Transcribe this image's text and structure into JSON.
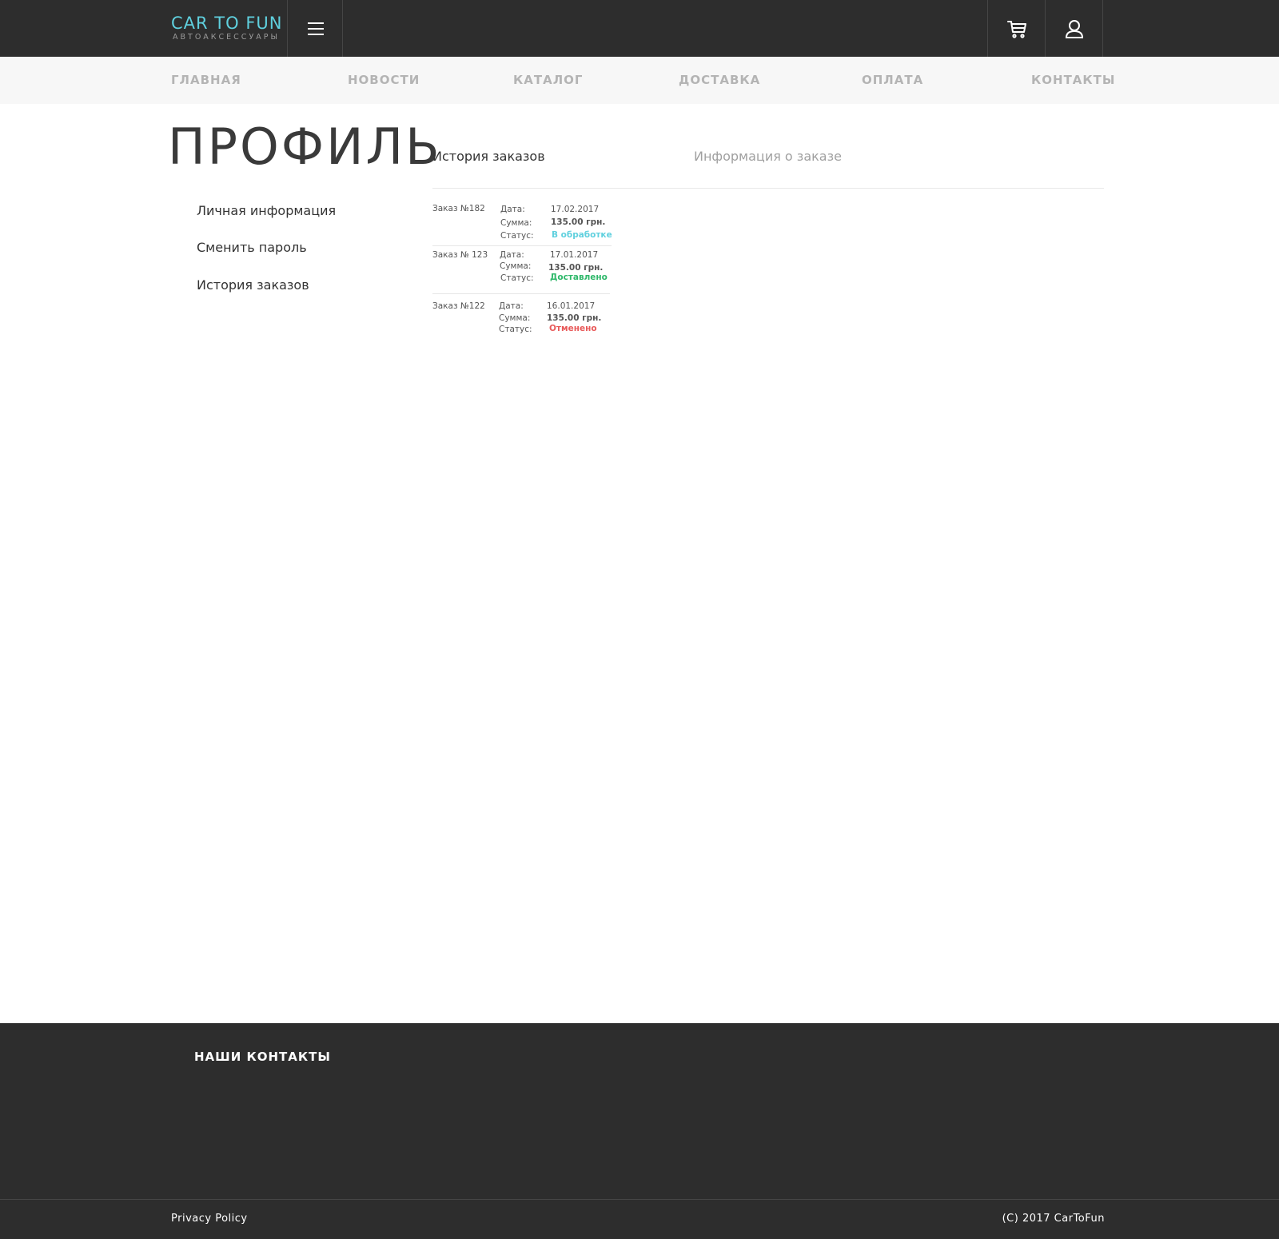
{
  "header": {
    "logo_title": "CAR TO FUN",
    "logo_subtitle": "АВТОАКСЕССУАРЫ",
    "menu_icon": "hamburger-menu-icon",
    "cart_icon": "cart-icon",
    "user_icon": "user-icon",
    "accent_color": "#5fd0de"
  },
  "nav": {
    "items": [
      {
        "label": "ГЛАВНАЯ"
      },
      {
        "label": "НОВОСТИ"
      },
      {
        "label": "КАТАЛОГ"
      },
      {
        "label": "ДОСТАВКА"
      },
      {
        "label": "ОПЛАТА"
      },
      {
        "label": "КОНТАКТЫ"
      }
    ]
  },
  "main": {
    "page_title": "ПРОФИЛЬ",
    "sidebar": [
      {
        "label": "Личная информация"
      },
      {
        "label": "Сменить пароль"
      },
      {
        "label": "История заказов"
      }
    ],
    "tabs": [
      {
        "label": "История заказов"
      },
      {
        "label": "Информация о заказе"
      }
    ],
    "labels": {
      "date": "Дата:",
      "sum": "Сумма:",
      "status": "Статус:"
    },
    "orders": [
      {
        "number": "Заказ №182",
        "date": "17.02.2017",
        "sum": "135.00 грн.",
        "status": "В обработке",
        "status_color": "#5fd0de"
      },
      {
        "number": "Заказ № 123",
        "date": "17.01.2017",
        "sum": "135.00 грн.",
        "status": "Доставлено",
        "status_color": "#2fb86a"
      },
      {
        "number": "Заказ №122",
        "date": "16.01.2017",
        "sum": "135.00 грн.",
        "status": "Отменено",
        "status_color": "#e85a5a"
      }
    ]
  },
  "footer": {
    "title": "НАШИ КОНТАКТЫ",
    "privacy": "Privacy Policy",
    "copyright": "(C) 2017 CarToFun"
  }
}
